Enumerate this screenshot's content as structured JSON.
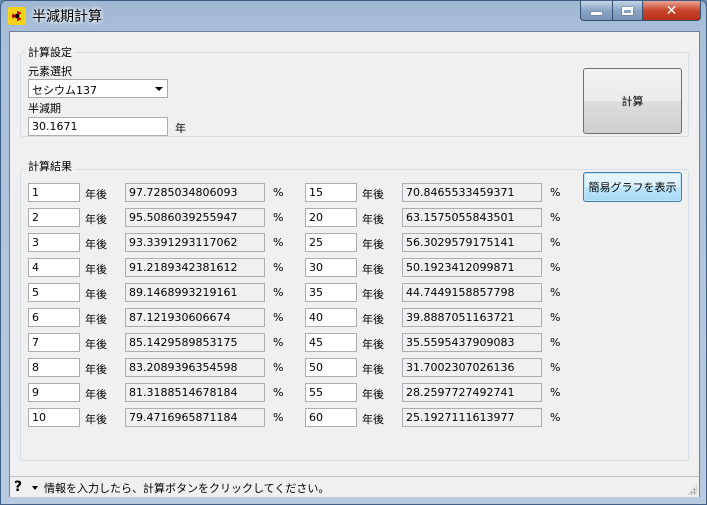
{
  "window": {
    "title": "半減期計算"
  },
  "settings": {
    "group_label": "計算設定",
    "element_label": "元素選択",
    "element_value": "セシウム137",
    "halflife_label": "半減期",
    "halflife_value": "30.1671",
    "halflife_unit": "年",
    "calc_button": "計算"
  },
  "results": {
    "group_label": "計算結果",
    "graph_button": "簡易グラフを表示",
    "year_suffix": "年後",
    "percent": "%",
    "left": [
      {
        "years": "1",
        "value": "97.7285034806093"
      },
      {
        "years": "2",
        "value": "95.5086039255947"
      },
      {
        "years": "3",
        "value": "93.3391293117062"
      },
      {
        "years": "4",
        "value": "91.2189342381612"
      },
      {
        "years": "5",
        "value": "89.1468993219161"
      },
      {
        "years": "6",
        "value": "87.121930606674"
      },
      {
        "years": "7",
        "value": "85.1429589853175"
      },
      {
        "years": "8",
        "value": "83.2089396354598"
      },
      {
        "years": "9",
        "value": "81.3188514678184"
      },
      {
        "years": "10",
        "value": "79.4716965871184"
      }
    ],
    "right": [
      {
        "years": "15",
        "value": "70.8465533459371"
      },
      {
        "years": "20",
        "value": "63.1575055843501"
      },
      {
        "years": "25",
        "value": "56.3029579175141"
      },
      {
        "years": "30",
        "value": "50.1923412099871"
      },
      {
        "years": "35",
        "value": "44.7449158857798"
      },
      {
        "years": "40",
        "value": "39.8887051163721"
      },
      {
        "years": "45",
        "value": "35.5595437909083"
      },
      {
        "years": "50",
        "value": "31.7002307026136"
      },
      {
        "years": "55",
        "value": "28.2597727492741"
      },
      {
        "years": "60",
        "value": "25.1927111613977"
      }
    ]
  },
  "status": {
    "text": "情報を入力したら、計算ボタンをクリックしてください。"
  }
}
